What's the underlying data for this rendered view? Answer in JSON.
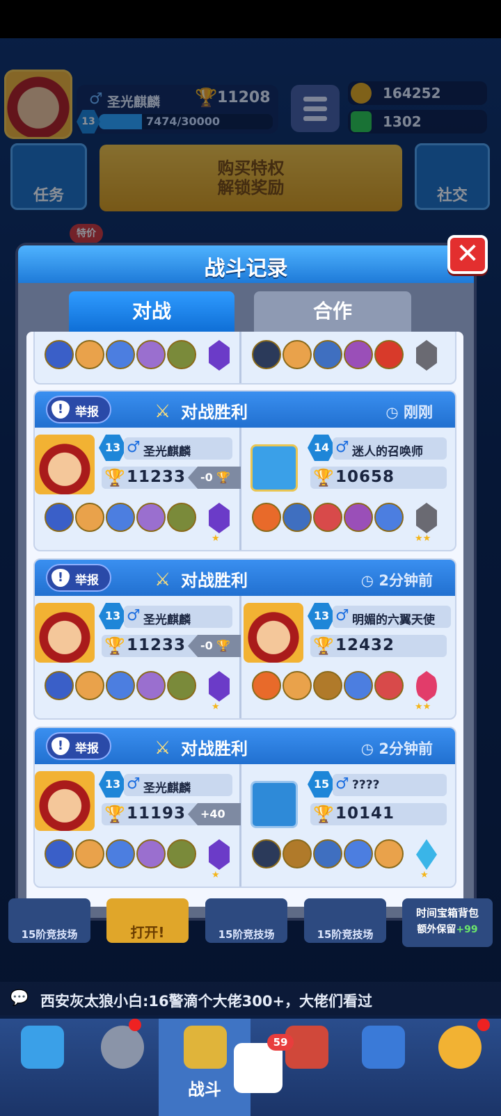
{
  "hud": {
    "player_name": "圣光麒麟",
    "trophies": "11208",
    "level": "13",
    "xp_text": "7474/30000",
    "xp_fraction": 0.249,
    "gold": "164252",
    "gems": "1302"
  },
  "top_buttons": {
    "task": "任务",
    "vip_line1": "购买特权",
    "vip_line2": "解锁奖励",
    "social": "社交",
    "sale": "特价"
  },
  "modal": {
    "title": "战斗记录",
    "tab_battle": "对战",
    "tab_coop": "合作"
  },
  "report_label": "举报",
  "matches": [
    {
      "result": "对战胜利",
      "time": "刚刚",
      "me": {
        "level": "13",
        "name": "圣光麒麟",
        "trophies": "11233",
        "delta": "-0"
      },
      "opp": {
        "level": "14",
        "name": "迷人的召唤师",
        "trophies": "10658"
      }
    },
    {
      "result": "对战胜利",
      "time": "2分钟前",
      "me": {
        "level": "13",
        "name": "圣光麒麟",
        "trophies": "11233",
        "delta": "-0"
      },
      "opp": {
        "level": "13",
        "name": "明媚的六翼天使",
        "trophies": "12432"
      }
    },
    {
      "result": "对战胜利",
      "time": "2分钟前",
      "me": {
        "level": "13",
        "name": "圣光麒麟",
        "trophies": "11193",
        "delta": "+40"
      },
      "opp": {
        "level": "15",
        "name": "????",
        "trophies": "10141"
      }
    }
  ],
  "chests": [
    "15阶竞技场",
    "打开!",
    "15阶竞技场",
    "15阶竞技场"
  ],
  "time_chest": {
    "line1": "时间宝箱背包",
    "line2": "额外保留",
    "bonus": "+99"
  },
  "chat": "西安灰太狼小白:16警滴个大佬300+，大佬们看过",
  "nav": {
    "battle": "战斗",
    "qq_badge": "59"
  }
}
